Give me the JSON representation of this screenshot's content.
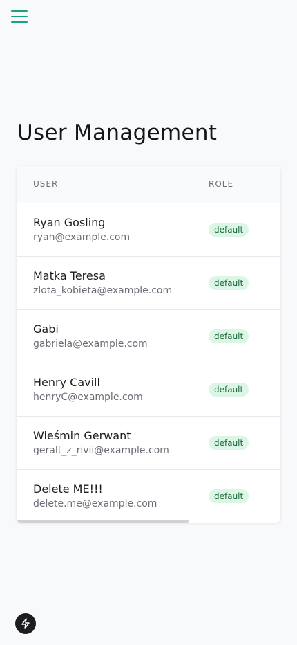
{
  "header": {
    "menu_icon": "hamburger-menu-icon",
    "accent_color": "#1aa184"
  },
  "page": {
    "title": "User Management"
  },
  "table": {
    "columns": {
      "user": "USER",
      "role": "ROLE"
    },
    "rows": [
      {
        "name": "Ryan Gosling",
        "email": "ryan@example.com",
        "role": "default"
      },
      {
        "name": "Matka Teresa",
        "email": "zlota_kobieta@example.com",
        "role": "default"
      },
      {
        "name": "Gabi",
        "email": "gabriela@example.com",
        "role": "default"
      },
      {
        "name": "Henry Cavill",
        "email": "henryC@example.com",
        "role": "default"
      },
      {
        "name": "Wieśmin Gerwant",
        "email": "geralt_z_rivii@example.com",
        "role": "default"
      },
      {
        "name": "Delete ME!!!",
        "email": "delete.me@example.com",
        "role": "default"
      }
    ],
    "badge_bg_color": "#dcf6e6",
    "badge_text_color": "#1f6b3f"
  },
  "floating_button": {
    "icon": "lightning-bolt-icon"
  }
}
